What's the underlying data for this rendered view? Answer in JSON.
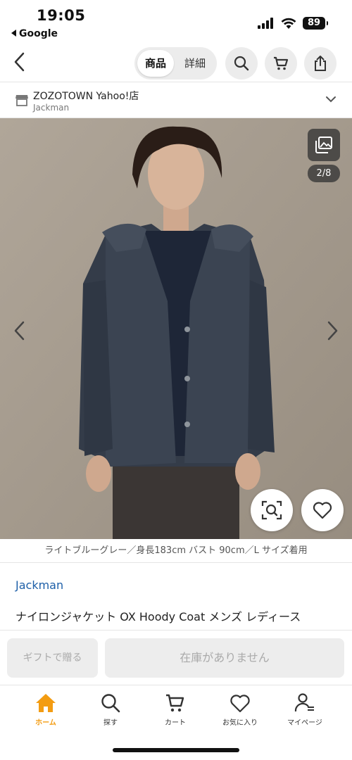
{
  "status_bar": {
    "time": "19:05",
    "back_app": "Google",
    "battery": "89"
  },
  "nav": {
    "segments": [
      {
        "label": "商品",
        "selected": true
      },
      {
        "label": "詳細",
        "selected": false
      }
    ],
    "icons": [
      "back-chevron-icon",
      "search-icon",
      "cart-icon",
      "share-icon"
    ]
  },
  "store": {
    "name": "ZOZOTOWN Yahoo!店",
    "sub": "Jackman"
  },
  "gallery": {
    "page_indicator": "2/8"
  },
  "image_caption": "ライトブルーグレー／身長183cm バスト 90cm／L サイズ着用",
  "product": {
    "brand": "Jackman",
    "title": "ナイロンジャケット OX Hoody Coat メンズ レディース"
  },
  "actions": {
    "gift": "ギフトで贈る",
    "stock": "在庫がありません"
  },
  "tabbar": {
    "accent": "#f39c12",
    "items": [
      {
        "label": "ホーム",
        "icon": "home-icon",
        "active": true
      },
      {
        "label": "探す",
        "icon": "search-icon",
        "active": false
      },
      {
        "label": "カート",
        "icon": "cart-icon",
        "active": false
      },
      {
        "label": "お気に入り",
        "icon": "heart-icon",
        "active": false
      },
      {
        "label": "マイページ",
        "icon": "user-icon",
        "active": false
      }
    ]
  }
}
